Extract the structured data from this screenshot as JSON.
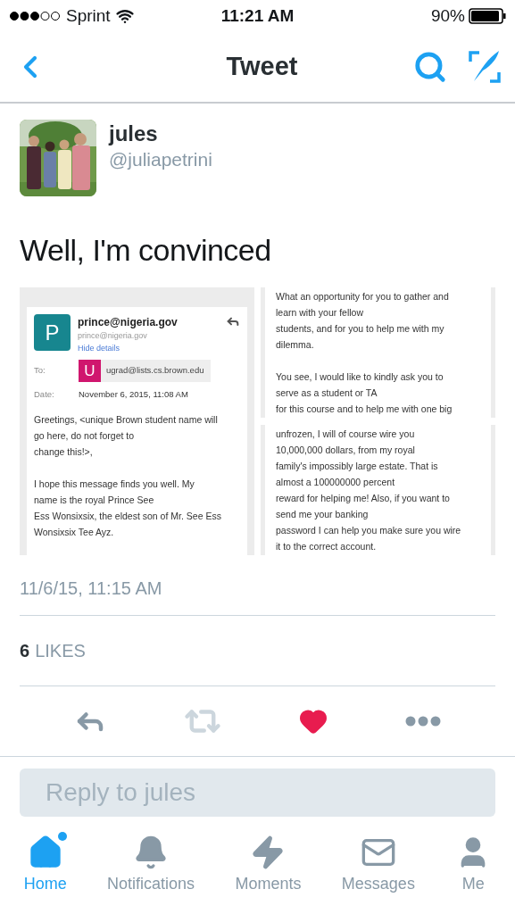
{
  "status_bar": {
    "carrier": "Sprint",
    "time": "11:21 AM",
    "battery": "90%"
  },
  "nav": {
    "title": "Tweet"
  },
  "tweet": {
    "name": "jules",
    "handle": "@juliapetrini",
    "text": "Well, I'm convinced",
    "email": {
      "avatar_letter": "P",
      "from": "prince@nigeria.gov",
      "from_address": "prince@nigeria.gov",
      "details_link": "Hide details",
      "to_label": "To:",
      "to_letter": "U",
      "to_address": "ugrad@lists.cs.brown.edu",
      "date_label": "Date:",
      "date": "November 6, 2015, 11:08 AM",
      "paragraphs": [
        "Greetings, <unique Brown student name will\ngo here, do not forget to\nchange this!>,",
        "I hope this message finds you well. My\nname is the royal Prince See\nEss Wonsixsix, the eldest son of Mr. See Ess\nWonsixsix Tee Ayz."
      ]
    },
    "excerpts": [
      {
        "paragraphs": [
          "What an opportunity for you to gather and\nlearn with your fellow\nstudents, and for you to help me with my\ndilemma.",
          "You see, I would like to kindly ask you to\nserve as a student or TA\nfor this course and to help me with one big"
        ]
      },
      {
        "paragraphs": [
          "unfrozen, I will of course wire you\n10,000,000 dollars, from my royal\nfamily's impossibly large estate. That is\nalmost a 100000000 percent\nreward for helping me! Also, if you want to\nsend me your banking\npassword I can help you make sure you wire\nit to the correct account."
        ]
      }
    ],
    "timestamp": "11/6/15, 11:15 AM",
    "likes_count": "6",
    "likes_label": "LIKES",
    "liked": true
  },
  "reply": {
    "placeholder": "Reply to jules"
  },
  "tabs": [
    {
      "label": "Home",
      "selected": true,
      "notification_dot": true,
      "kind": "home"
    },
    {
      "label": "Notifications",
      "selected": false,
      "notification_dot": false,
      "kind": "bell"
    },
    {
      "label": "Moments",
      "selected": false,
      "notification_dot": false,
      "kind": "bolt"
    },
    {
      "label": "Messages",
      "selected": false,
      "notification_dot": false,
      "kind": "mail"
    },
    {
      "label": "Me",
      "selected": false,
      "notification_dot": false,
      "kind": "person"
    }
  ]
}
